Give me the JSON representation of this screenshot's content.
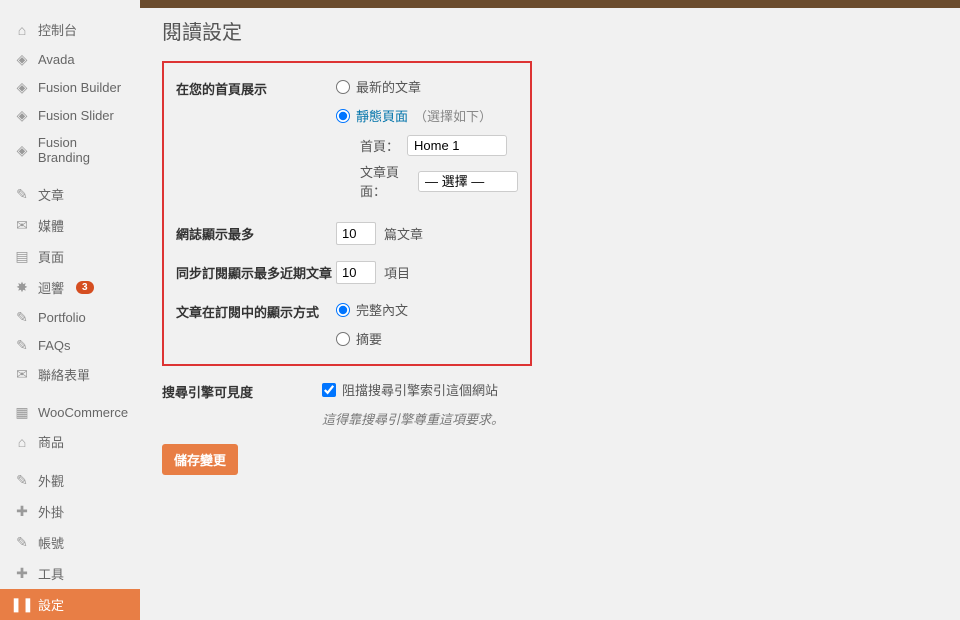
{
  "sidebar": {
    "items": [
      {
        "icon": "⌂",
        "label": "控制台"
      },
      {
        "icon": "◈",
        "label": "Avada"
      },
      {
        "icon": "◈",
        "label": "Fusion Builder"
      },
      {
        "icon": "◈",
        "label": "Fusion Slider"
      },
      {
        "icon": "◈",
        "label": "Fusion Branding"
      },
      {
        "sep": true
      },
      {
        "icon": "✎",
        "label": "文章"
      },
      {
        "icon": "✉",
        "label": "媒體"
      },
      {
        "icon": "▤",
        "label": "頁面"
      },
      {
        "icon": "✸",
        "label": "迴響",
        "badge": "3"
      },
      {
        "icon": "✎",
        "label": "Portfolio"
      },
      {
        "icon": "✎",
        "label": "FAQs"
      },
      {
        "icon": "✉",
        "label": "聯絡表單"
      },
      {
        "sep": true
      },
      {
        "icon": "▦",
        "label": "WooCommerce"
      },
      {
        "icon": "⌂",
        "label": "商品"
      },
      {
        "sep": true
      },
      {
        "icon": "✎",
        "label": "外觀"
      },
      {
        "icon": "✚",
        "label": "外掛"
      },
      {
        "icon": "✎",
        "label": "帳號"
      },
      {
        "icon": "✚",
        "label": "工具"
      },
      {
        "icon": "❚❚",
        "label": "設定",
        "current": true
      }
    ]
  },
  "page": {
    "title": "閱讀設定"
  },
  "form": {
    "front_label": "在您的首頁展示",
    "opt_latest": "最新的文章",
    "opt_static": "靜態頁面",
    "opt_static_hint": "（選擇如下）",
    "homepage_label": "首頁：",
    "homepage_value": "Home 1",
    "posts_label": "文章頁面：",
    "posts_value": "— 選擇 —",
    "blog_max_label": "網誌顯示最多",
    "blog_max_value": "10",
    "blog_max_suffix": "篇文章",
    "feed_max_label": "同步訂閱顯示最多近期文章",
    "feed_max_value": "10",
    "feed_max_suffix": "項目",
    "feed_mode_label": "文章在訂閱中的顯示方式",
    "feed_full": "完整內文",
    "feed_summary": "摘要",
    "seo_label": "搜尋引擎可見度",
    "seo_check": "阻擋搜尋引擎索引這個網站",
    "seo_note": "這得靠搜尋引擎尊重這項要求。",
    "save": "儲存變更"
  }
}
